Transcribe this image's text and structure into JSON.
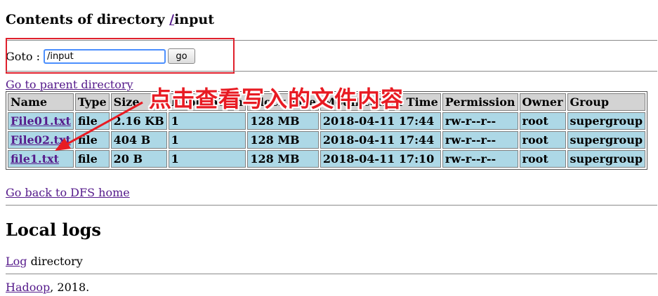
{
  "page": {
    "title_prefix": "Contents of directory ",
    "title_root_link": "/",
    "title_dir": "input"
  },
  "goto": {
    "label": "Goto :",
    "input_value": "/input",
    "button_label": "go"
  },
  "links": {
    "parent": "Go to parent directory",
    "back_home": "Go back to DFS home"
  },
  "table": {
    "headers": [
      "Name",
      "Type",
      "Size",
      "Replication",
      "Block Size",
      "Modification Time",
      "Permission",
      "Owner",
      "Group"
    ],
    "rows": [
      [
        "File01.txt",
        "file",
        "2.16 KB",
        "1",
        "128 MB",
        "2018-04-11 17:44",
        "rw-r--r--",
        "root",
        "supergroup"
      ],
      [
        "File02.txt",
        "file",
        "404 B",
        "1",
        "128 MB",
        "2018-04-11 17:44",
        "rw-r--r--",
        "root",
        "supergroup"
      ],
      [
        "file1.txt",
        "file",
        "20 B",
        "1",
        "128 MB",
        "2018-04-11 17:10",
        "rw-r--r--",
        "root",
        "supergroup"
      ]
    ]
  },
  "local_logs": {
    "heading": "Local logs",
    "log_link": "Log",
    "log_suffix": " directory"
  },
  "footer": {
    "hadoop_link": "Hadoop",
    "suffix": ", 2018."
  },
  "annotation": {
    "text": "点击查看写入的文件内容",
    "color": "#e81b23"
  }
}
